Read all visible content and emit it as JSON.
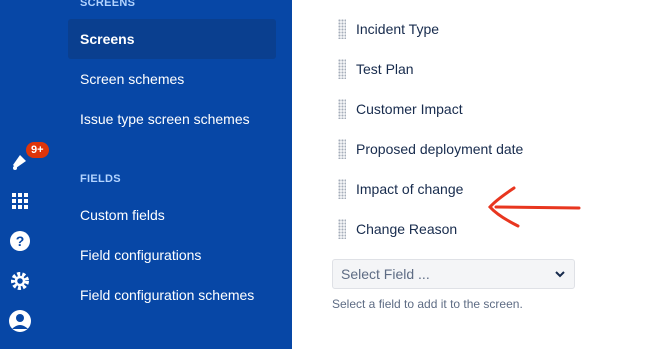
{
  "notifications": {
    "badge": "9+"
  },
  "sidebar": {
    "screens_section": "SCREENS",
    "screens_items": [
      {
        "label": "Screens",
        "selected": true
      },
      {
        "label": "Screen schemes"
      },
      {
        "label": "Issue type screen schemes"
      }
    ],
    "fields_section": "FIELDS",
    "fields_items": [
      {
        "label": "Custom fields"
      },
      {
        "label": "Field configurations"
      },
      {
        "label": "Field configuration schemes"
      }
    ]
  },
  "main": {
    "fields": [
      {
        "label": "Incident Type"
      },
      {
        "label": "Test Plan"
      },
      {
        "label": "Customer Impact"
      },
      {
        "label": "Proposed deployment date"
      },
      {
        "label": "Impact of change"
      },
      {
        "label": "Change Reason"
      }
    ],
    "select_field_placeholder": "Select Field ...",
    "select_hint": "Select a field to add it to the screen."
  },
  "colors": {
    "rail": "#0747a6",
    "selected_item": "#0a3f8f",
    "annotation_arrow": "#e8361f",
    "badge": "#de350b"
  },
  "icons": [
    "megaphone-icon",
    "app-switcher-icon",
    "help-icon",
    "settings-icon",
    "profile-icon",
    "drag-handle-icon",
    "chevron-down-icon",
    "annotation-arrow-icon"
  ]
}
